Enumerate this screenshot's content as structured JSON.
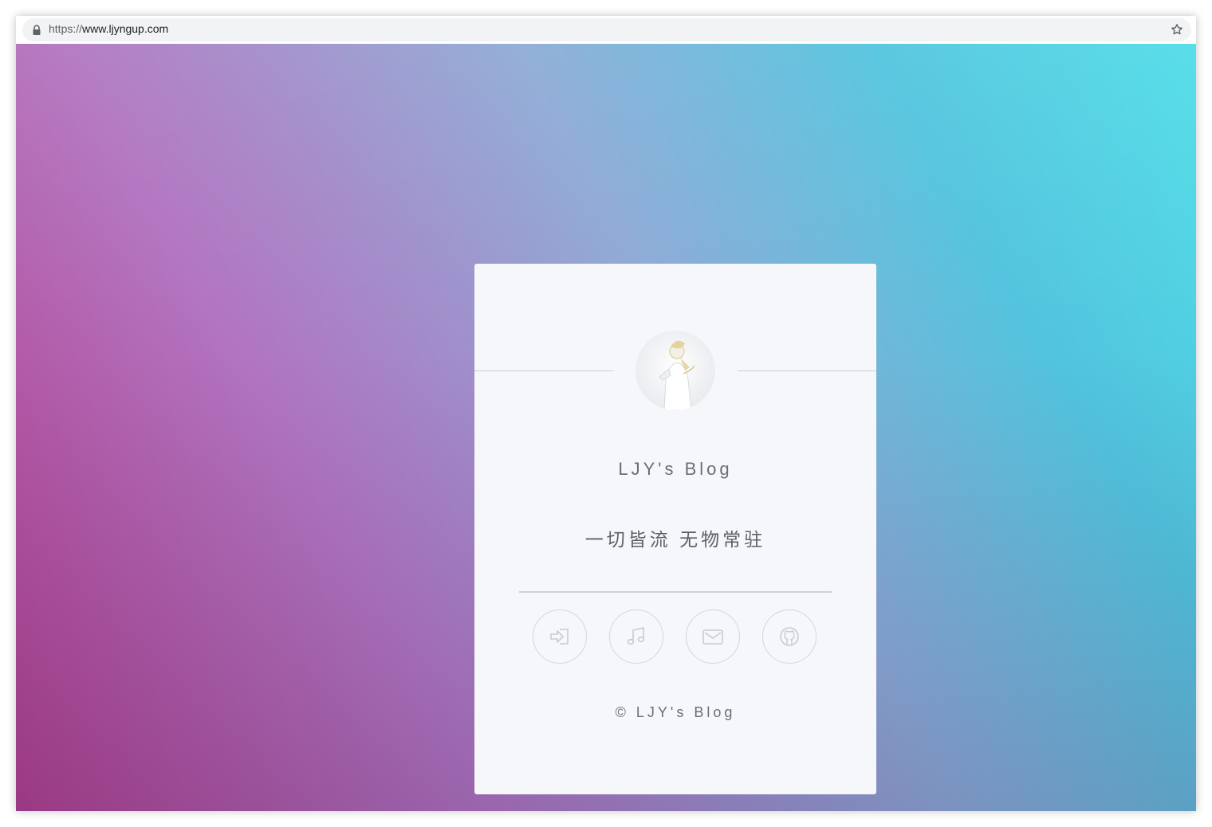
{
  "browser": {
    "url_scheme": "https://",
    "url_host": "www.ljyngup.com"
  },
  "card": {
    "title": "LJY's Blog",
    "tagline": "一切皆流 无物常驻",
    "footer": "© LJY's Blog",
    "social_icons": [
      "login-icon",
      "music-icon",
      "mail-icon",
      "github-icon"
    ]
  },
  "colors": {
    "gradient_start": "#b43d8c",
    "gradient_mid": "#8eaad6",
    "gradient_end": "#4fdde8",
    "card_bg": "#f6f7fa"
  }
}
